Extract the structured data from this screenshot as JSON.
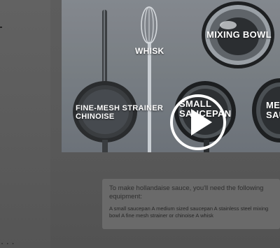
{
  "media": {
    "labels": {
      "whisk": "WHISK",
      "mixing_bowl": "MIXING BOWL",
      "strainer": "FINE-MESH STRAINER\nCHINOISE",
      "small_saucepan": "SMALL\nSAUCEPAN",
      "medium_saucepan": "ME\nSAU"
    },
    "play_icon": "play-icon"
  },
  "caption": {
    "intro": "To make hollandaise sauce, you'll need the following equipment:",
    "list_line1": "A small saucepan A medium sized saucepan A stainless steel mixing",
    "list_line2": "bowl A fine mesh strainer or chinoise A whisk"
  },
  "left_panel": {
    "dots": "• • •"
  }
}
